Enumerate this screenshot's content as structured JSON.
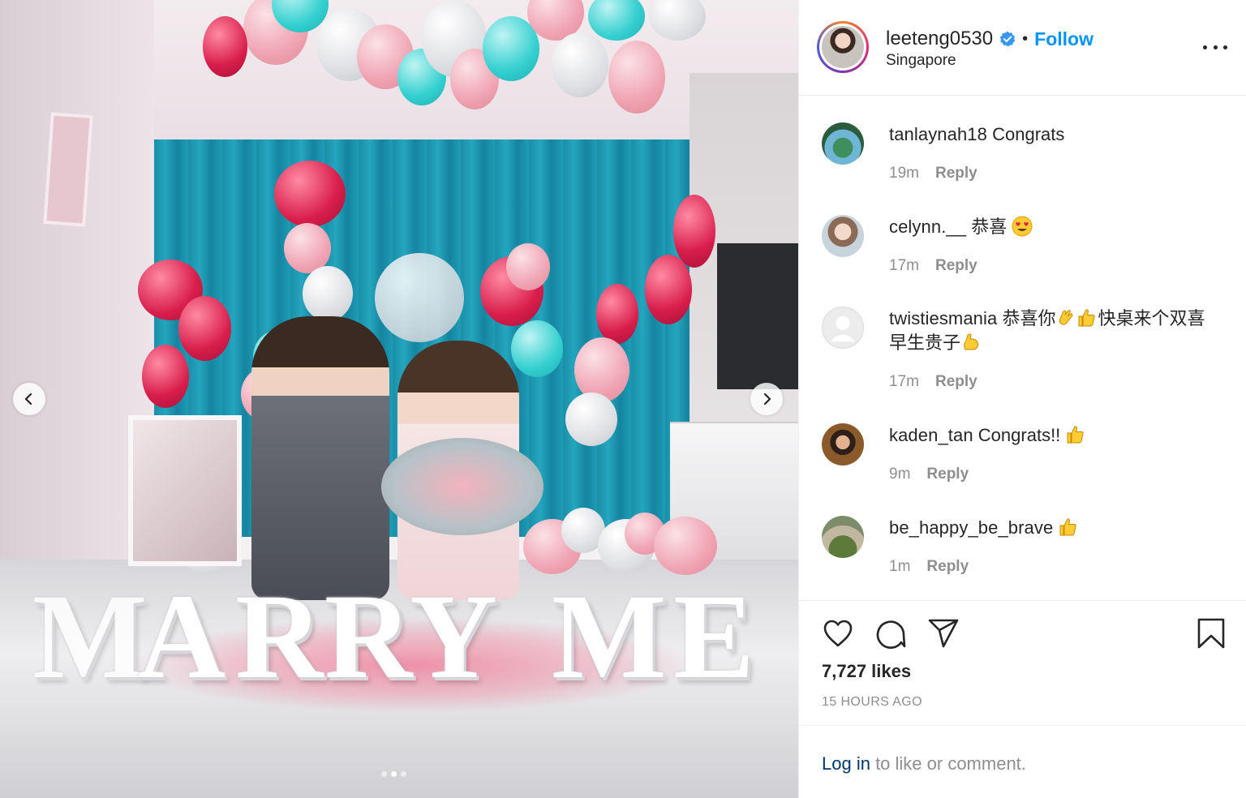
{
  "post": {
    "author": {
      "username": "leeteng0530",
      "verified": true,
      "follow_label": "Follow",
      "separator": "•",
      "location": "Singapore"
    },
    "photo": {
      "sign_letters": [
        "M",
        "A",
        "R",
        "R",
        "Y",
        "M",
        "E"
      ],
      "carousel_dots": 3,
      "active_dot": 1
    },
    "comments": [
      {
        "username": "tanlaynah18",
        "text": "Congrats",
        "emoji": [],
        "time": "19m",
        "reply_label": "Reply"
      },
      {
        "username": "celynn.__",
        "text": "恭喜",
        "emoji": [
          "heart-eyes-emoji"
        ],
        "time": "17m",
        "reply_label": "Reply"
      },
      {
        "username": "twistiesmania",
        "text_parts": [
          "恭喜你",
          "快桌来个双喜早生贵子"
        ],
        "emoji": [
          "clapping-hands-emoji",
          "thumbs-up-emoji",
          "flexed-biceps-emoji"
        ],
        "time": "17m",
        "reply_label": "Reply"
      },
      {
        "username": "kaden_tan",
        "text": "Congrats!!",
        "emoji": [
          "thumbs-up-emoji"
        ],
        "time": "9m",
        "reply_label": "Reply"
      },
      {
        "username": "be_happy_be_brave",
        "text": "",
        "emoji": [
          "thumbs-up-emoji"
        ],
        "time": "1m",
        "reply_label": "Reply"
      }
    ],
    "likes": "7,727 likes",
    "time_ago": "15 HOURS AGO",
    "login_prompt": {
      "link": "Log in",
      "rest": " to like or comment."
    }
  },
  "colors": {
    "link_blue": "#0095f6",
    "text_primary": "#262626",
    "text_secondary": "#8e8e8e",
    "login_link": "#00376b"
  }
}
